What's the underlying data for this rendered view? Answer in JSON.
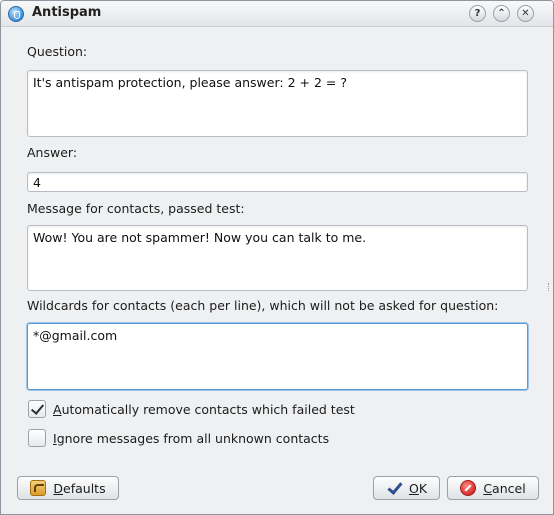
{
  "window": {
    "title": "Antispam",
    "help_glyph": "?",
    "shade_glyph": "⌃",
    "close_glyph": "✕"
  },
  "form": {
    "question_label": "Question:",
    "question_value": "It's antispam protection, please answer: 2 + 2 = ?",
    "answer_label": "Answer:",
    "answer_value": "4",
    "message_label": "Message for contacts, passed test:",
    "message_value": "Wow! You are not spammer! Now you can talk to me.",
    "wildcards_label": "Wildcards for contacts (each per line), which will not be asked for question:",
    "wildcards_value": "*@gmail.com"
  },
  "options": {
    "auto_remove": {
      "prefix": "A",
      "label": "utomatically remove contacts which failed test",
      "checked": true
    },
    "ignore_unknown": {
      "prefix": "I",
      "label": "gnore messages from all unknown contacts",
      "checked": false
    }
  },
  "buttons": {
    "defaults_prefix": "D",
    "defaults_label": "efaults",
    "ok_prefix": "O",
    "ok_label": "K",
    "cancel_prefix": "C",
    "cancel_label": "ancel"
  },
  "icons": {
    "app": "antispam-app-icon",
    "help": "help-icon",
    "shade": "shade-icon",
    "close": "close-icon",
    "defaults": "defaults-icon",
    "ok": "checkmark-icon",
    "cancel": "cancel-icon"
  },
  "colors": {
    "focus_border": "#5b9bd5",
    "cancel_red": "#d32f2f",
    "ok_blue": "#2f4f8f"
  }
}
